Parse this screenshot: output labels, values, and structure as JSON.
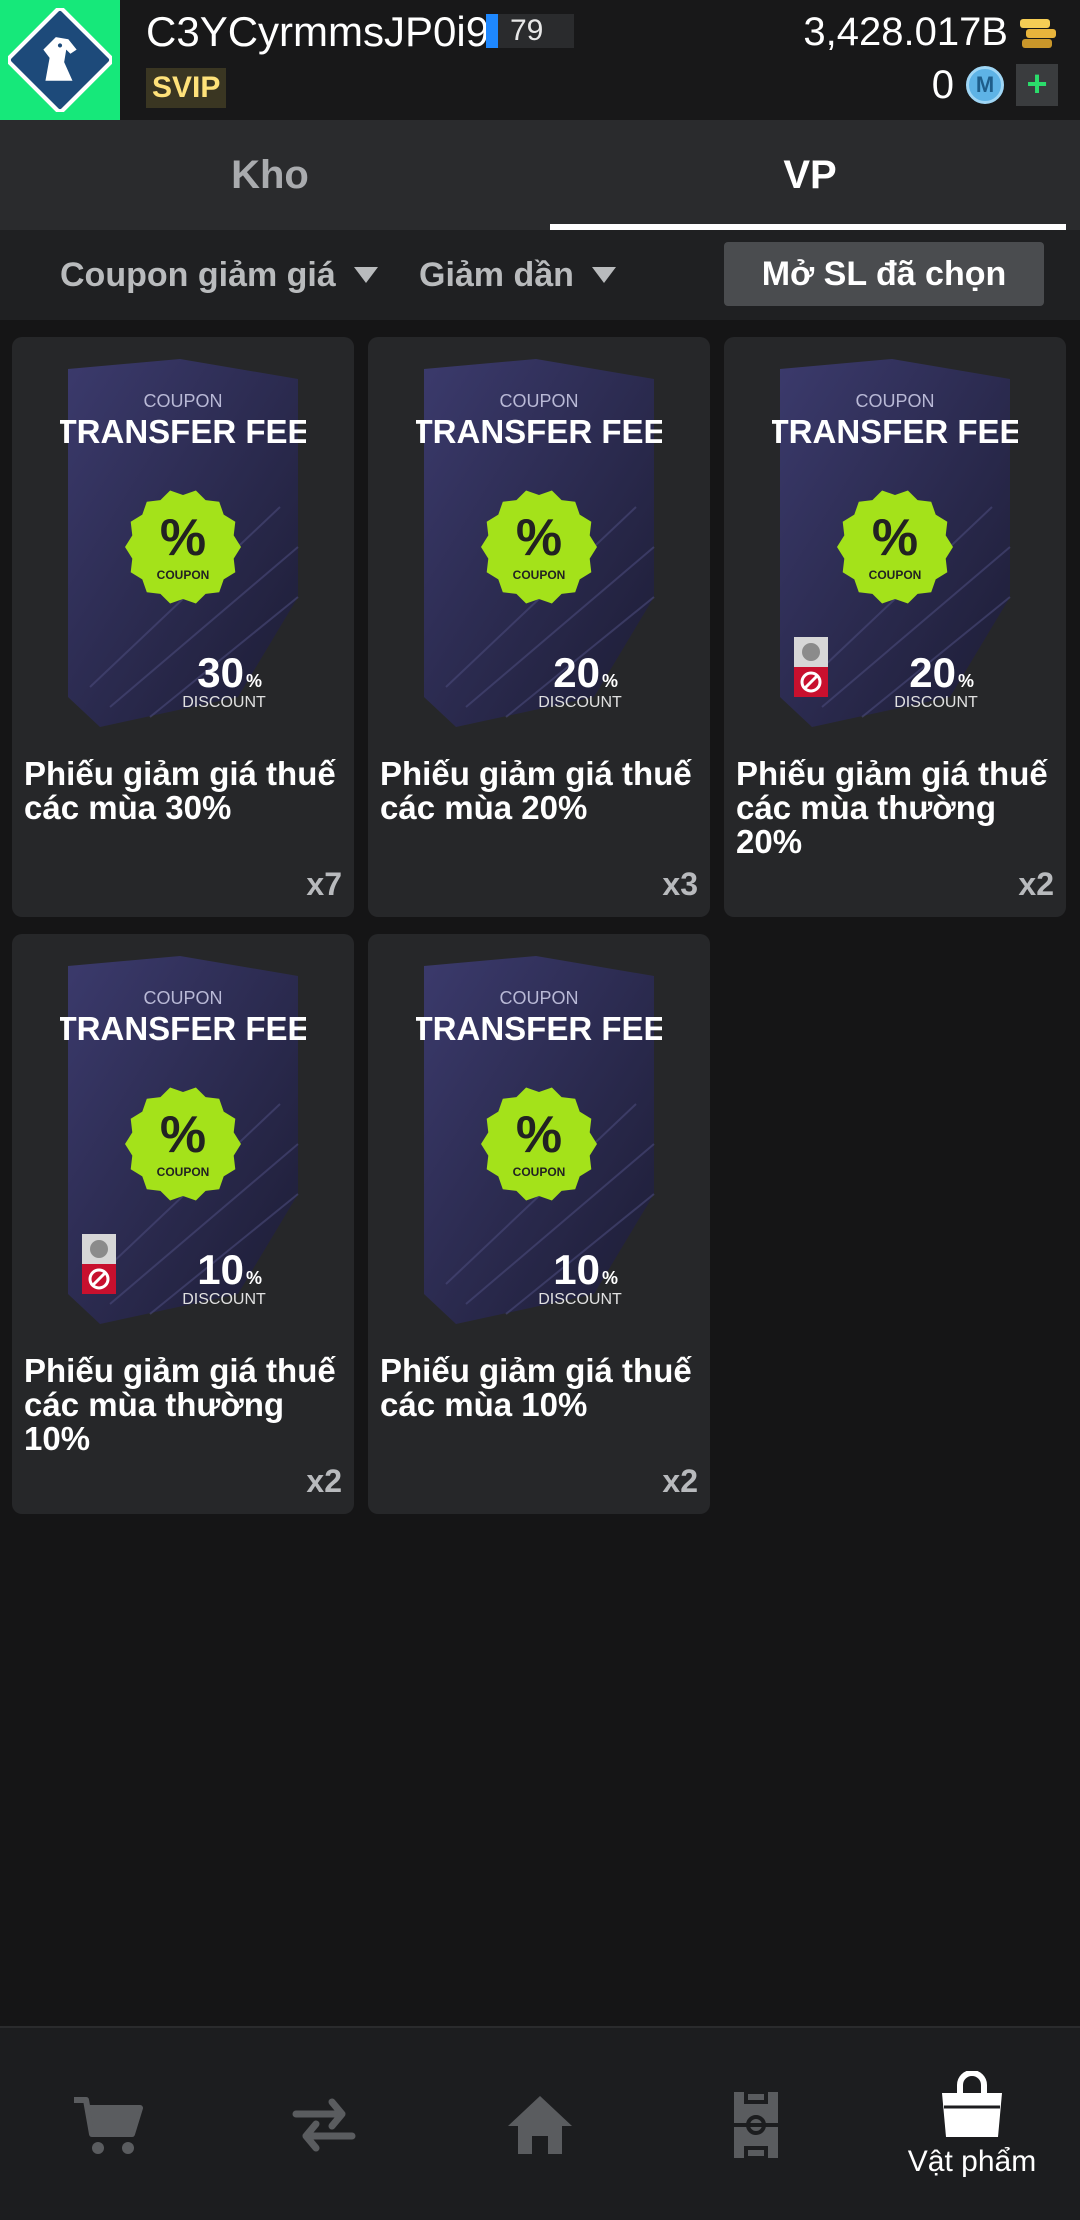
{
  "header": {
    "username": "C3YCyrmmsJP0i9",
    "level": "79",
    "vip": "SVIP",
    "coins": "3,428.017B",
    "m_points": "0",
    "m_icon_label": "M",
    "plus_label": "+"
  },
  "tabs": [
    {
      "label": "Kho",
      "active": false
    },
    {
      "label": "VP",
      "active": true
    }
  ],
  "filters": {
    "category": "Coupon giảm giá",
    "sort": "Giảm dần",
    "open_selected": "Mở SL đã chọn"
  },
  "coupon_art_text": {
    "kicker": "COUPON",
    "headline": "TRANSFER FEE",
    "badge_symbol": "%",
    "badge_label": "COUPON",
    "discount_label": "DISCOUNT"
  },
  "items": [
    {
      "name": "Phiếu giảm giá thuế các mùa 30%",
      "discount": "30",
      "quantity": "x7",
      "restricted": false
    },
    {
      "name": "Phiếu giảm giá thuế các mùa 20%",
      "discount": "20",
      "quantity": "x3",
      "restricted": false
    },
    {
      "name": "Phiếu giảm giá thuế các mùa thường 20%",
      "discount": "20",
      "quantity": "x2",
      "restricted": true
    },
    {
      "name": "Phiếu giảm giá thuế các mùa thường 10%",
      "discount": "10",
      "quantity": "x2",
      "restricted": true
    },
    {
      "name": "Phiếu giảm giá thuế các mùa 10%",
      "discount": "10",
      "quantity": "x2",
      "restricted": false
    }
  ],
  "bottom_nav": [
    {
      "icon": "cart-icon",
      "label": "",
      "active": false
    },
    {
      "icon": "transfer-arrows-icon",
      "label": "",
      "active": false
    },
    {
      "icon": "home-icon",
      "label": "",
      "active": false
    },
    {
      "icon": "pitch-icon",
      "label": "",
      "active": false
    },
    {
      "icon": "shopping-bag-icon",
      "label": "Vật phẩm",
      "active": true
    }
  ],
  "colors": {
    "background": "#151516",
    "logo_bg": "#16e87a",
    "level_bar": "#1e88ff",
    "badge_green": "#a4e21a",
    "coupon_card": "#2b2a4e",
    "restricted_red": "#c8102e"
  }
}
